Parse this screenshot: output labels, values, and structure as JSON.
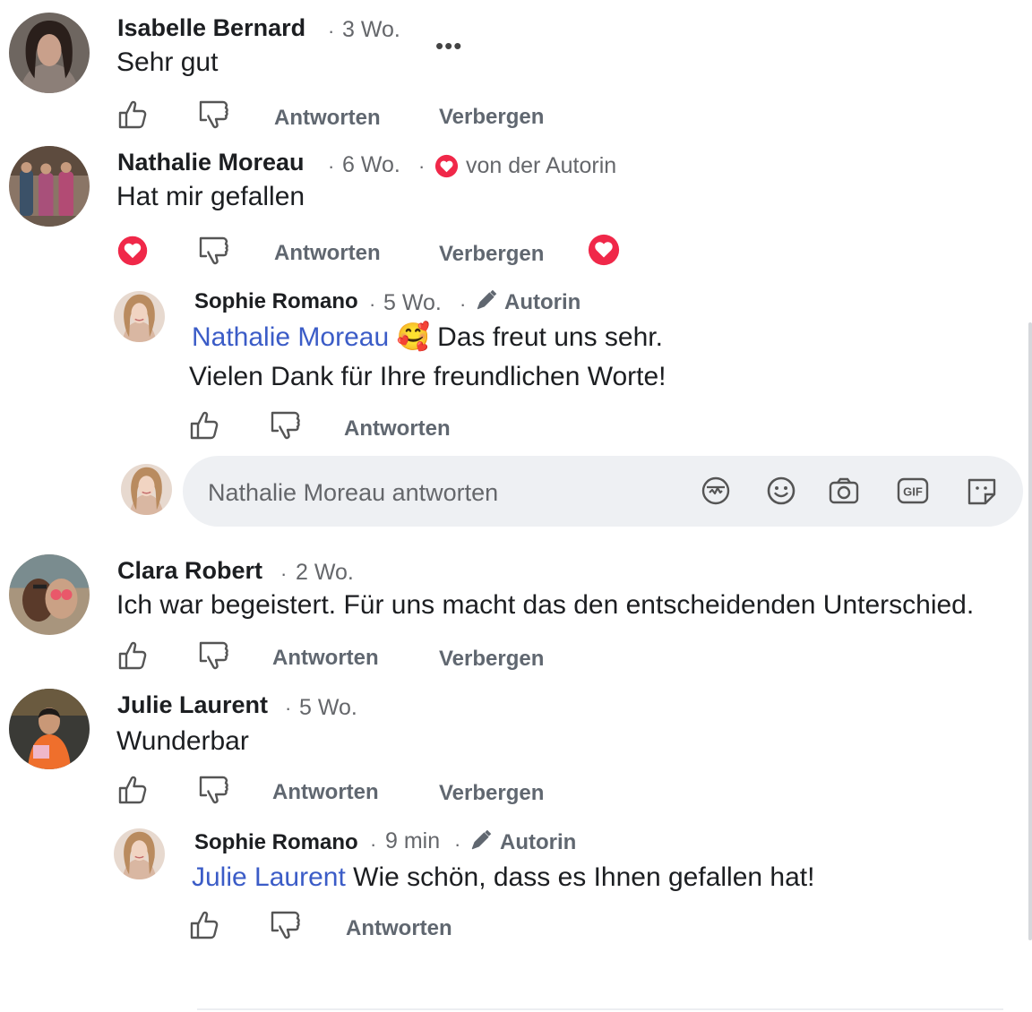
{
  "comments": [
    {
      "author": "Isabelle Bernard",
      "sep": "·",
      "time": "3 Wo.",
      "text": "Sehr gut",
      "more": "•••"
    },
    {
      "author": "Nathalie Moreau",
      "sep": "·",
      "time": "6 Wo.",
      "sep2": "·",
      "author_like": "von der Autorin",
      "text": "Hat mir gefallen"
    },
    {
      "author": "Clara Robert",
      "sep": "·",
      "time": "2 Wo.",
      "text": "Ich war begeistert. Für uns macht das den entscheidenden Unterschied."
    },
    {
      "author": "Julie Laurent",
      "sep": "·",
      "time": "5 Wo.",
      "text": "Wunderbar"
    }
  ],
  "replies": [
    {
      "author": "Sophie Romano",
      "sep": "·",
      "time": "5 Wo.",
      "sep2": "·",
      "badge": "Autorin",
      "mention": "Nathalie Moreau",
      "emoji": "🥰",
      "text_line1": "Das freut uns sehr.",
      "text_line2": "Vielen Dank für Ihre freundlichen Worte!"
    },
    {
      "author": "Sophie Romano",
      "sep": "·",
      "time": "9 min",
      "sep2": "·",
      "badge": "Autorin",
      "mention": "Julie Laurent",
      "text_line1": "Wie schön, dass es Ihnen gefallen hat!"
    }
  ],
  "actions": {
    "reply": "Antworten",
    "hide": "Verbergen"
  },
  "composer": {
    "placeholder": "Nathalie Moreau antworten",
    "icons": [
      "avatar-sticker-icon",
      "emoji-icon",
      "camera-icon",
      "gif-icon",
      "sticker-icon"
    ],
    "gif_label": "GIF"
  },
  "colors": {
    "mention": "#3b5cc7",
    "heart": "#f02849",
    "action": "#606770",
    "meta": "#65676b",
    "composer_bg": "#eef0f3"
  }
}
